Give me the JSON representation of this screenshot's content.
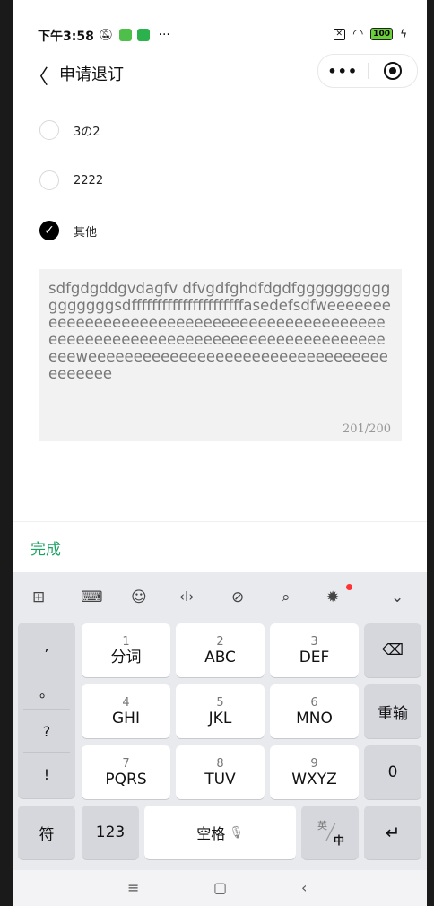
{
  "status_bar": {
    "time": "下午3:58",
    "dots": "···",
    "battery": "100"
  },
  "nav": {
    "back_glyph": "〈",
    "title": "申请退订",
    "more_glyph": "•••"
  },
  "options": [
    {
      "label": "3の2",
      "checked": false
    },
    {
      "label": "2222",
      "checked": false
    },
    {
      "label": "其他",
      "checked": true
    }
  ],
  "textarea": {
    "value": "sdfgdgddgvdagfv dfvgdfghdfdgdfgggggggggggggggggsdffffffffffffffffffffffasedefsdfweeeeeeeeeeeeeeeeeeeeeeeeeeeeeeeeeeeeeeeeeeeeeeeeeeeeeeeeeeeeeeeeeeeeeeeeeeeeeeeeeeeeweeeeeeeeeeeeeeeeeeeeeeeeeeeeeeeeeeeeeeee",
    "counter": "201/200"
  },
  "done_label": "完成",
  "keyboard": {
    "punct": [
      ",",
      "。",
      "?",
      "!"
    ],
    "keys": [
      {
        "num": "1",
        "main": "分词"
      },
      {
        "num": "2",
        "main": "ABC"
      },
      {
        "num": "3",
        "main": "DEF"
      },
      {
        "num": "4",
        "main": "GHI"
      },
      {
        "num": "5",
        "main": "JKL"
      },
      {
        "num": "6",
        "main": "MNO"
      },
      {
        "num": "7",
        "main": "PQRS"
      },
      {
        "num": "8",
        "main": "TUV"
      },
      {
        "num": "9",
        "main": "WXYZ"
      }
    ],
    "backspace_glyph": "⌫",
    "reenter": "重输",
    "zero": "0",
    "symbol": "符",
    "num_mode": "123",
    "space": "空格",
    "lang_top": "英",
    "lang_bottom": "中",
    "enter_glyph": "↵"
  },
  "colors": {
    "accent_green": "#1aa260",
    "checked": "#000000",
    "textarea_bg": "#f2f2f2"
  }
}
